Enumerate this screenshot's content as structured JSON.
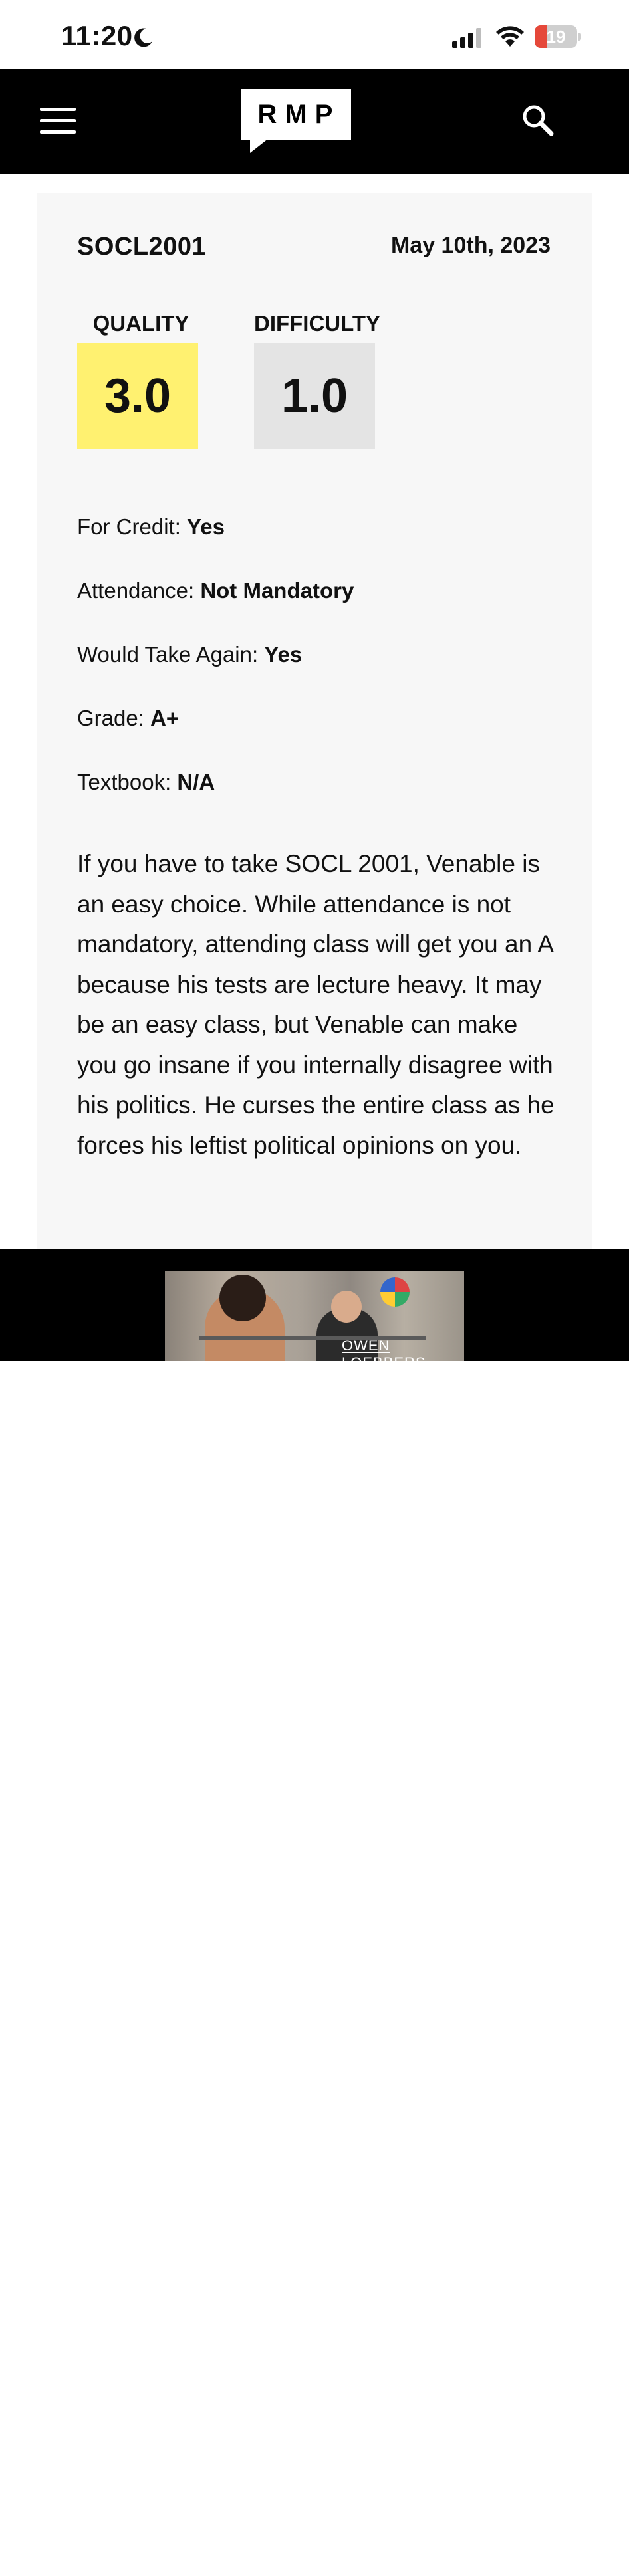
{
  "status_bar": {
    "time": "11:20",
    "battery_level": "19",
    "battery_fraction": 0.19,
    "icons": [
      "moon-icon",
      "signal-icon",
      "wifi-icon",
      "battery-icon"
    ]
  },
  "nav": {
    "logo": "RMP",
    "icons": [
      "menu-icon",
      "search-icon"
    ]
  },
  "rating": {
    "course": "SOCL2001",
    "date": "May 10th, 2023",
    "quality_label": "QUALITY",
    "quality_value": "3.0",
    "difficulty_label": "DIFFICULTY",
    "difficulty_value": "1.0",
    "details": [
      {
        "label": "For Credit: ",
        "value": "Yes"
      },
      {
        "label": "Attendance: ",
        "value": "Not Mandatory"
      },
      {
        "label": "Would Take Again: ",
        "value": "Yes"
      },
      {
        "label": "Grade: ",
        "value": "A+"
      },
      {
        "label": "Textbook: ",
        "value": "N/A"
      }
    ],
    "review": "If you have to take SOCL 2001, Venable is an easy choice. While attendance is not mandatory, attending class will get you an A because his tests are lecture heavy. It may be an easy class, but Venable can make you go insane if you internally disagree with his politics. He curses the entire class as he forces his leftist political opinions on you."
  },
  "ad": {
    "caption": "OWEN LOEBBERS"
  },
  "colors": {
    "quality": "#fff170",
    "difficulty": "#e4e4e4",
    "nav_bg": "#000000",
    "card_bg": "#f7f7f7"
  }
}
